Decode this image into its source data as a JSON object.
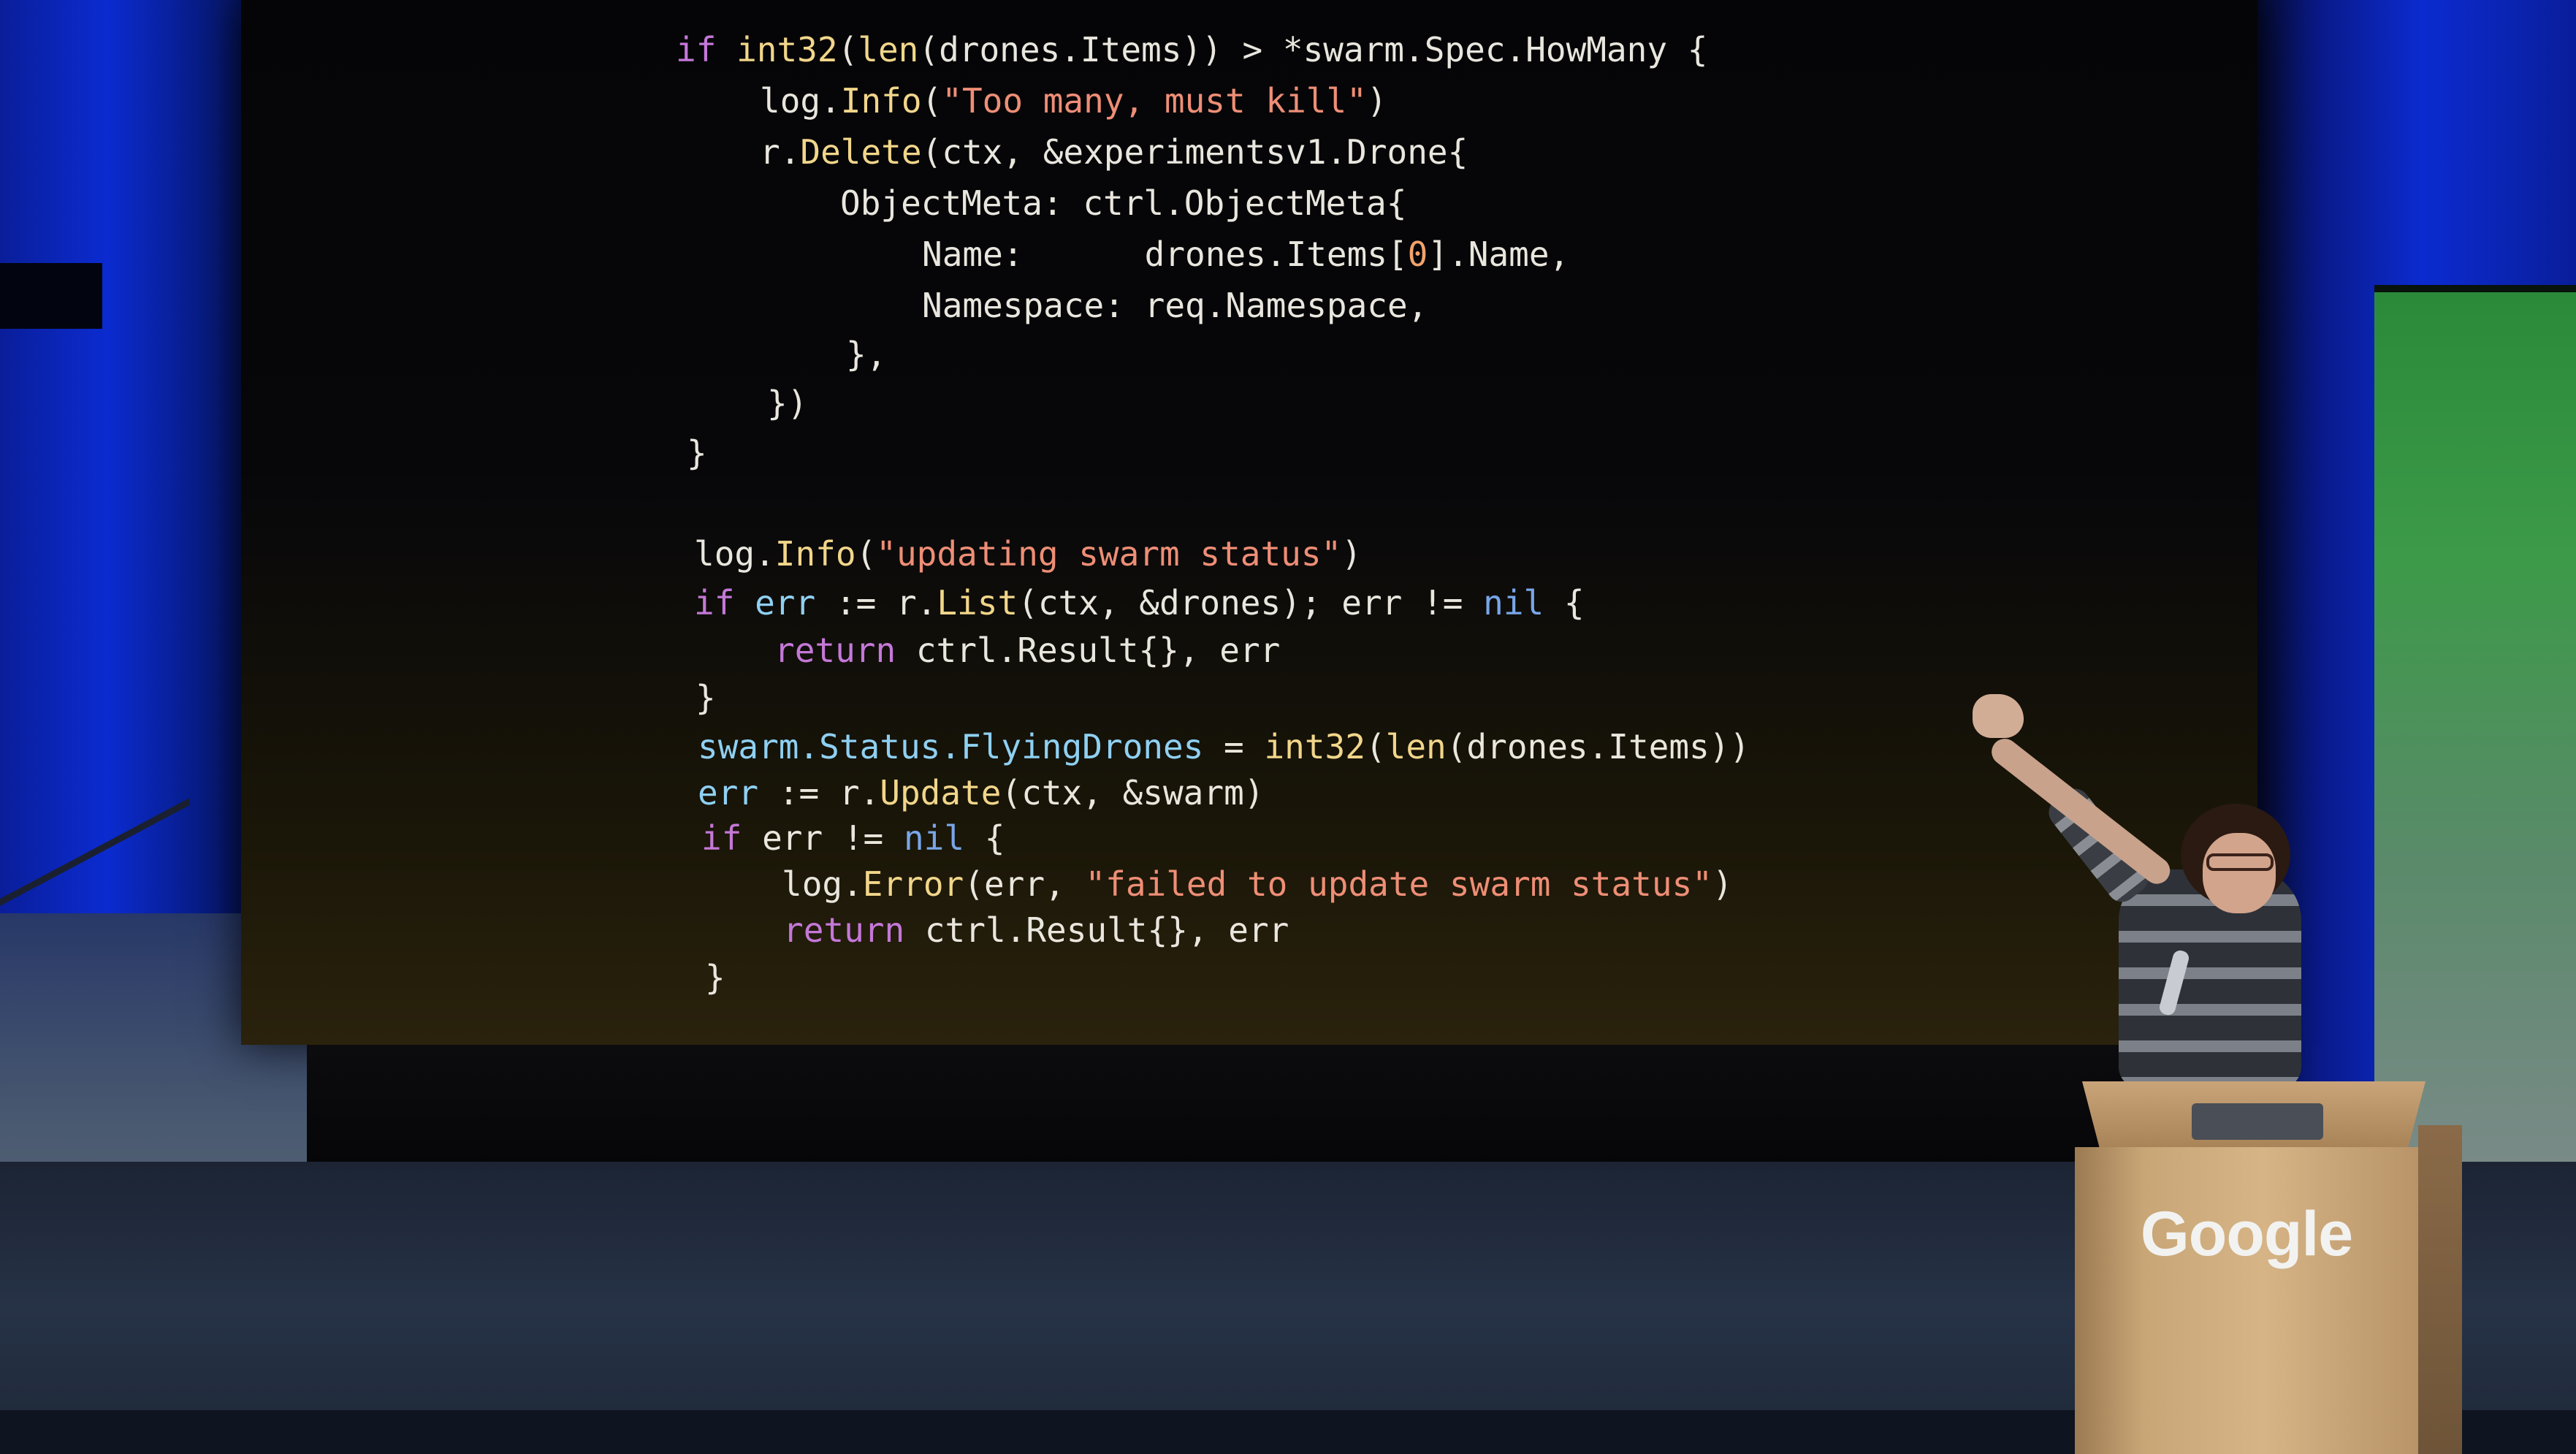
{
  "scene": {
    "description_items": [
      "projection-screen",
      "code-slide",
      "speaker",
      "podium"
    ]
  },
  "code": {
    "lines": [
      {
        "segments": [
          {
            "t": "if",
            "c": "kw"
          },
          {
            "t": " ",
            "c": ""
          },
          {
            "t": "int32",
            "c": "fn"
          },
          {
            "t": "(",
            "c": ""
          },
          {
            "t": "len",
            "c": "fn"
          },
          {
            "t": "(drones.Items)) > *swarm.Spec.HowMany {",
            "c": ""
          }
        ]
      },
      {
        "segments": [
          {
            "t": "log.",
            "c": ""
          },
          {
            "t": "Info",
            "c": "fn"
          },
          {
            "t": "(",
            "c": ""
          },
          {
            "t": "\"Too many, must kill\"",
            "c": "str"
          },
          {
            "t": ")",
            "c": ""
          }
        ]
      },
      {
        "segments": [
          {
            "t": "r.",
            "c": ""
          },
          {
            "t": "Delete",
            "c": "fn"
          },
          {
            "t": "(ctx, &experimentsv1.Drone{",
            "c": ""
          }
        ]
      },
      {
        "segments": [
          {
            "t": "ObjectMeta: ctrl.ObjectMeta{",
            "c": ""
          }
        ]
      },
      {
        "segments": [
          {
            "t": "Name:      drones.Items[",
            "c": ""
          },
          {
            "t": "0",
            "c": "nm"
          },
          {
            "t": "].Name,",
            "c": ""
          }
        ]
      },
      {
        "segments": [
          {
            "t": "Namespace: req.Namespace,",
            "c": ""
          }
        ]
      },
      {
        "segments": [
          {
            "t": "},",
            "c": ""
          }
        ]
      },
      {
        "segments": [
          {
            "t": "})",
            "c": ""
          }
        ]
      },
      {
        "segments": [
          {
            "t": "}",
            "c": ""
          }
        ]
      },
      {
        "segments": [
          {
            "t": "log.",
            "c": ""
          },
          {
            "t": "Info",
            "c": "fn"
          },
          {
            "t": "(",
            "c": ""
          },
          {
            "t": "\"updating swarm status\"",
            "c": "str"
          },
          {
            "t": ")",
            "c": ""
          }
        ]
      },
      {
        "segments": [
          {
            "t": "if",
            "c": "kw"
          },
          {
            "t": " ",
            "c": ""
          },
          {
            "t": "err",
            "c": "vr"
          },
          {
            "t": " := r.",
            "c": ""
          },
          {
            "t": "List",
            "c": "fn"
          },
          {
            "t": "(ctx, &drones); err != ",
            "c": ""
          },
          {
            "t": "nil",
            "c": "nil"
          },
          {
            "t": " {",
            "c": ""
          }
        ]
      },
      {
        "segments": [
          {
            "t": "return",
            "c": "kw"
          },
          {
            "t": " ctrl.Result{}, err",
            "c": ""
          }
        ]
      },
      {
        "segments": [
          {
            "t": "}",
            "c": ""
          }
        ]
      },
      {
        "segments": [
          {
            "t": "swarm.Status.FlyingDrones",
            "c": "vr"
          },
          {
            "t": " = ",
            "c": ""
          },
          {
            "t": "int32",
            "c": "fn"
          },
          {
            "t": "(",
            "c": ""
          },
          {
            "t": "len",
            "c": "fn"
          },
          {
            "t": "(drones.Items))",
            "c": ""
          }
        ]
      },
      {
        "segments": [
          {
            "t": "err",
            "c": "vr"
          },
          {
            "t": " := r.",
            "c": ""
          },
          {
            "t": "Update",
            "c": "fn"
          },
          {
            "t": "(ctx, &swarm)",
            "c": ""
          }
        ]
      },
      {
        "segments": [
          {
            "t": "if",
            "c": "kw"
          },
          {
            "t": " err != ",
            "c": ""
          },
          {
            "t": "nil",
            "c": "nil"
          },
          {
            "t": " {",
            "c": ""
          }
        ]
      },
      {
        "segments": [
          {
            "t": "log.",
            "c": ""
          },
          {
            "t": "Error",
            "c": "fn"
          },
          {
            "t": "(err, ",
            "c": ""
          },
          {
            "t": "\"failed to update swarm status\"",
            "c": "str"
          },
          {
            "t": ")",
            "c": ""
          }
        ]
      },
      {
        "segments": [
          {
            "t": "return",
            "c": "kw"
          },
          {
            "t": " ctrl.Result{}, err",
            "c": ""
          }
        ]
      },
      {
        "segments": [
          {
            "t": "}",
            "c": ""
          }
        ]
      }
    ]
  },
  "podium": {
    "logo_text": "Google"
  },
  "colors": {
    "keyword": "#c478d8",
    "function": "#f1d68a",
    "string": "#ee8e76",
    "nil": "#79a6e8",
    "variable": "#8fd0f2",
    "number": "#f2a36c",
    "plain": "#e9e6de"
  }
}
